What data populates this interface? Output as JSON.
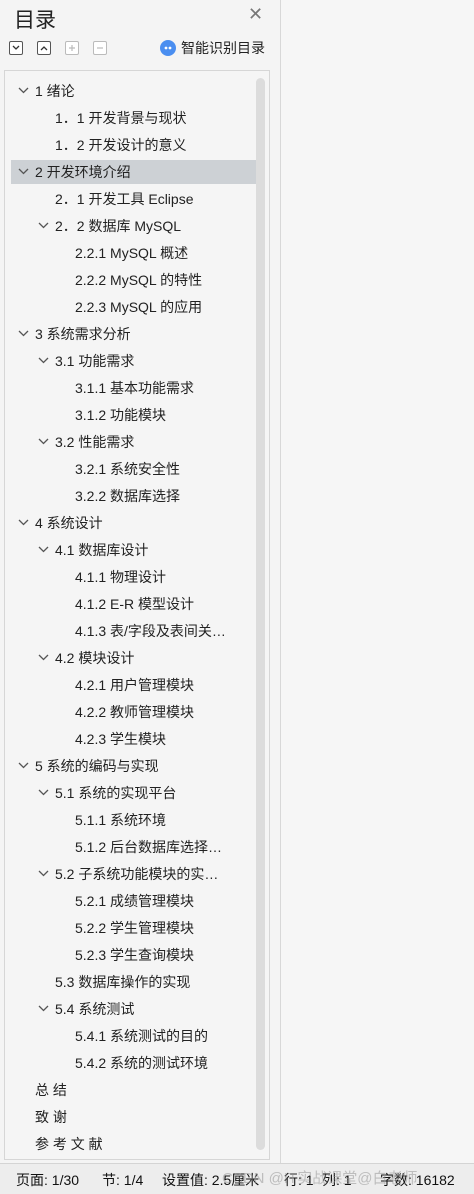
{
  "panel": {
    "title": "目录",
    "close_icon": "close-icon",
    "smart_label": "智能识别目录"
  },
  "toolbar": {
    "collapse": "collapse-all-icon",
    "expand": "expand-all-icon",
    "add": "add-icon",
    "remove": "remove-icon"
  },
  "toc": [
    {
      "text": "1  绪论",
      "expanded": true
    },
    {
      "text": "1．1  开发背景与现状"
    },
    {
      "text": "1．2    开发设计的意义"
    },
    {
      "text": "2    开发环境介绍",
      "expanded": true,
      "selected": true
    },
    {
      "text": "2．1    开发工具  Eclipse"
    },
    {
      "text": "2．2      数据库  MySQL",
      "expanded": true
    },
    {
      "text": "2.2.1    MySQL 概述"
    },
    {
      "text": "2.2.2    MySQL 的特性"
    },
    {
      "text": "2.2.3      MySQL 的应用"
    },
    {
      "text": "3    系统需求分析",
      "expanded": true
    },
    {
      "text": "3.1    功能需求",
      "expanded": true
    },
    {
      "text": "3.1.1  基本功能需求"
    },
    {
      "text": "3.1.2  功能模块"
    },
    {
      "text": "3.2    性能需求",
      "expanded": true
    },
    {
      "text": "3.2.1 系统安全性"
    },
    {
      "text": "3.2.2  数据库选择"
    },
    {
      "text": "4    系统设计",
      "expanded": true
    },
    {
      "text": "4.1    数据库设计",
      "expanded": true
    },
    {
      "text": "4.1.1  物理设计"
    },
    {
      "text": "4.1.2    E-R 模型设计"
    },
    {
      "text": "4.1.3    表/字段及表间关…"
    },
    {
      "text": "4.2    模块设计",
      "expanded": true
    },
    {
      "text": "4.2.1      用户管理模块"
    },
    {
      "text": "4.2.2      教师管理模块"
    },
    {
      "text": "4.2.3      学生模块"
    },
    {
      "text": "5    系统的编码与实现",
      "expanded": true
    },
    {
      "text": "5.1    系统的实现平台",
      "expanded": true
    },
    {
      "text": "5.1.1  系统环境"
    },
    {
      "text": "5.1.2    后台数据库选择…"
    },
    {
      "text": "5.2    子系统功能模块的实…",
      "expanded": true
    },
    {
      "text": "5.2.1    成绩管理模块"
    },
    {
      "text": "5.2.2    学生管理模块"
    },
    {
      "text": "5.2.3    学生查询模块"
    },
    {
      "text": "5.3    数据库操作的实现"
    },
    {
      "text": "5.4    系统测试",
      "expanded": true
    },
    {
      "text": "5.4.1    系统测试的目的"
    },
    {
      "text": "5.4.2    系统的测试环境"
    },
    {
      "text": "总    结"
    },
    {
      "text": "致    谢"
    },
    {
      "text": "参  考  文  献"
    }
  ],
  "status": {
    "page": "页面: 1/30",
    "section": "节: 1/4",
    "setting": "设置值: 2.5厘米",
    "row": "行: 1",
    "col": "列: 1",
    "words": "字数: 16182"
  },
  "watermark": "CSDN @IT实战课堂@白老师"
}
